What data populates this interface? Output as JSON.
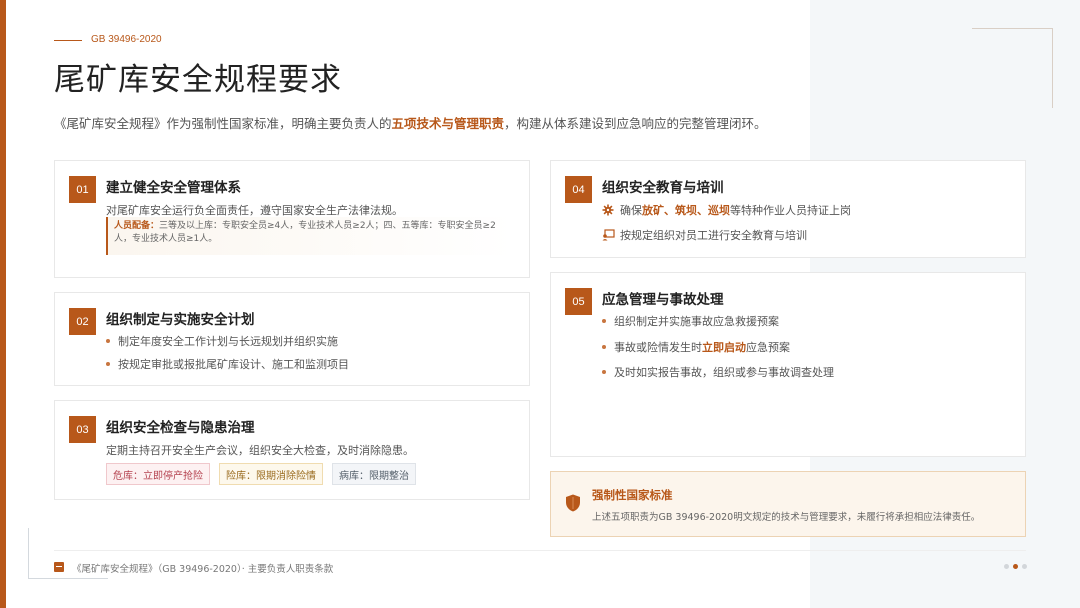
{
  "header": {
    "std_tag": "GB 39496-2020",
    "title": "尾矿库安全规程要求",
    "subtitle_pre": "《尾矿库安全规程》作为强制性国家标准，明确主要负责人的",
    "subtitle_hl": "五项技术与管理职责",
    "subtitle_post": "，构建从体系建设到应急响应的完整管理闭环。"
  },
  "cards": {
    "c1": {
      "num": "01",
      "title": "建立健全安全管理体系",
      "desc": "对尾矿库安全运行负全面责任，遵守国家安全生产法律法规。",
      "staff_label": "人员配备：",
      "staff_text": "三等及以上库：专职安全员≥4人，专业技术人员≥2人；四、五等库：专职安全员≥2人，专业技术人员≥1人。"
    },
    "c2": {
      "num": "02",
      "title": "组织制定与实施安全计划",
      "bullets": [
        "制定年度安全工作计划与长远规划并组织实施",
        "按规定审批或报批尾矿库设计、施工和监测项目"
      ]
    },
    "c3": {
      "num": "03",
      "title": "组织安全检查与隐患治理",
      "desc": "定期主持召开安全生产会议，组织安全大检查，及时消除隐患。",
      "tags": [
        "危库：立即停产抢险",
        "险库：限期消除险情",
        "病库：限期整治"
      ]
    },
    "c4": {
      "num": "04",
      "title": "组织安全教育与培训",
      "row1_pre": "确保",
      "row1_hl": "放矿、筑坝、巡坝",
      "row1_post": "等特种作业人员持证上岗",
      "row2": "按规定组织对员工进行安全教育与培训",
      "icons": [
        "gear-icon",
        "training-icon"
      ]
    },
    "c5": {
      "num": "05",
      "title": "应急管理与事故处理",
      "bullet1": "组织制定并实施事故应急救援预案",
      "bullet2_pre": "事故或险情发生时",
      "bullet2_hl": "立即启动",
      "bullet2_post": "应急预案",
      "bullet3": "及时如实报告事故，组织或参与事故调查处理"
    }
  },
  "mandatory": {
    "icon": "shield-icon",
    "title": "强制性国家标准",
    "text": "上述五项职责为GB 39496-2020明文规定的技术与管理要求，未履行将承担相应法律责任。"
  },
  "footer": {
    "icon": "book-icon",
    "text": "《尾矿库安全规程》（GB 39496-2020）· 主要负责人职责条款",
    "page_count": 3,
    "active_page": 2
  },
  "colors": {
    "accent": "#b8581a",
    "panel": "#f4f7f9",
    "danger": "#b54350",
    "warning": "#9a6b1e"
  }
}
